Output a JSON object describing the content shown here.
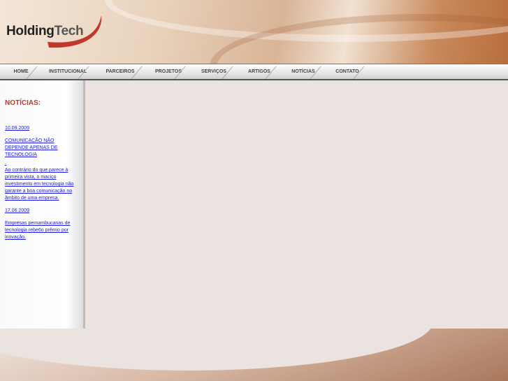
{
  "logo": {
    "text_a": "Holding",
    "text_b": "Tech"
  },
  "nav": [
    "HOME",
    "INSTITUCIONAL",
    "PARCEIROS",
    "PROJETOS",
    "SERVIÇOS",
    "ARTIGOS",
    "NOTÍCIAS",
    "CONTATO"
  ],
  "sidebar": {
    "title": "NOTÍCIAS:",
    "items": [
      {
        "date": "10.09.2009",
        "headline": "COMUNICAÇÃO NÃO DEPENDE APENAS DE TECNOLOGIA",
        "dot": ".",
        "summary": "Ao contrário do que parece à primeira vista, o maciço investimento em tecnologia não garante a boa comunicação no âmbito de uma empresa."
      },
      {
        "date": "17.06.2009",
        "headline": "Empresas pernambucanas de tecnologia rebe6o prêmio por inovação."
      }
    ]
  }
}
